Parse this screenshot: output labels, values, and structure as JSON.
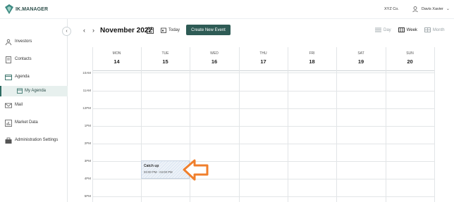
{
  "header": {
    "logo_text": "IK.MANAGER",
    "org": "XYZ Co.",
    "user_name": "Davis Xavier"
  },
  "sidebar": {
    "items": [
      {
        "label": "Investors",
        "icon": "investors-icon"
      },
      {
        "label": "Contacts",
        "icon": "contacts-icon"
      },
      {
        "label": "Agenda",
        "icon": "agenda-icon"
      },
      {
        "label": "My Agenda",
        "icon": "calendar-icon"
      },
      {
        "label": "Mail",
        "icon": "mail-icon"
      },
      {
        "label": "Market Data",
        "icon": "chart-icon"
      },
      {
        "label": "Administration Settings",
        "icon": "briefcase-icon"
      }
    ]
  },
  "toolbar": {
    "month": "November 2022",
    "today_label": "Today",
    "create_label": "Create New Event",
    "views": {
      "day": "Day",
      "week": "Week",
      "month": "Month"
    },
    "active_view": "Week"
  },
  "calendar": {
    "days": [
      {
        "name": "MON",
        "num": "14"
      },
      {
        "name": "TUE",
        "num": "15"
      },
      {
        "name": "WED",
        "num": "16"
      },
      {
        "name": "THU",
        "num": "17"
      },
      {
        "name": "FRI",
        "num": "18"
      },
      {
        "name": "SAT",
        "num": "19"
      },
      {
        "name": "SUN",
        "num": "20"
      }
    ],
    "times": [
      "10AM",
      "11AM",
      "12PM",
      "1PM",
      "2PM",
      "3PM",
      "4PM",
      "5PM"
    ],
    "event": {
      "title": "Catch up",
      "time": "03:00 PM - 04:00 PM",
      "day": "TUE"
    }
  },
  "colors": {
    "brand": "#2e5b55",
    "accent_bg": "#e7f0ee",
    "pointer": "#f07f2c"
  }
}
